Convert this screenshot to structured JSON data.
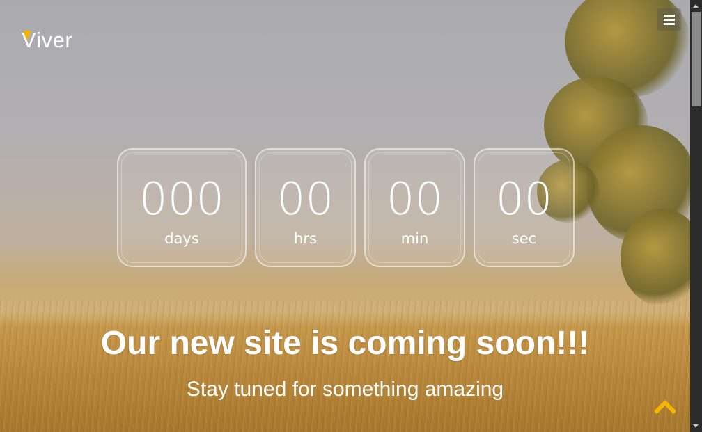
{
  "brand": {
    "logo_text": "Viver",
    "logo_first_letter": "V",
    "logo_rest": "iver",
    "accent_color": "#f5b400"
  },
  "menu": {
    "icon": "hamburger-menu-icon"
  },
  "countdown": {
    "days": {
      "value": "000",
      "label": "days"
    },
    "hours": {
      "value": "00",
      "label": "hrs"
    },
    "minutes": {
      "value": "00",
      "label": "min"
    },
    "seconds": {
      "value": "00",
      "label": "sec"
    }
  },
  "hero": {
    "headline": "Our new site is coming soon!!!",
    "subline": "Stay tuned for something amazing"
  },
  "back_to_top": {
    "icon": "chevron-up-icon"
  },
  "scrollbar": {
    "position_fraction": 0.0
  }
}
